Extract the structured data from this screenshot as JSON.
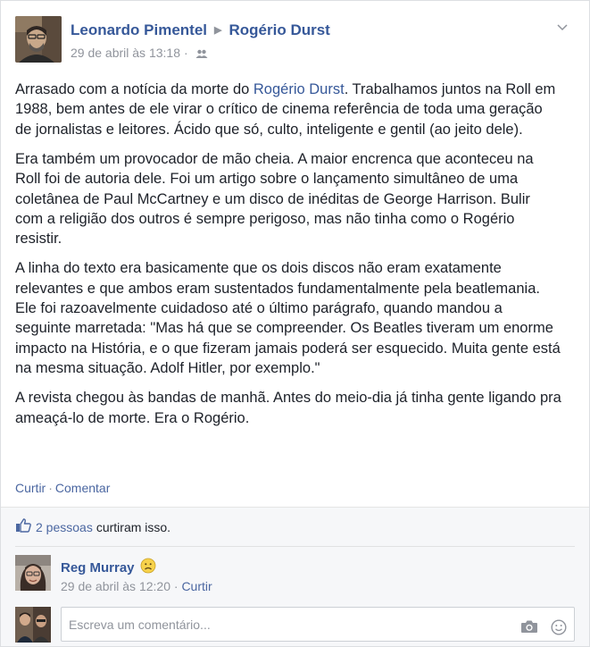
{
  "post": {
    "author": "Leonardo Pimentel",
    "target": "Rogério Durst",
    "timestamp": "29 de abril às 13:18",
    "paragraphs": [
      {
        "before": "Arrasado com a notícia da morte do ",
        "mention": "Rogério Durst",
        "after": ". Trabalhamos juntos na Roll em 1988, bem antes de ele virar o crítico de cinema referência de toda uma geração de jornalistas e leitores. Ácido que só, culto, inteligente e gentil (ao jeito dele)."
      },
      {
        "text": "Era também um provocador de mão cheia. A maior encrenca que aconteceu na Roll foi de autoria dele. Foi um artigo sobre o lançamento simultâneo de uma coletânea de Paul McCartney e um disco de inéditas de George Harrison. Bulir com a religião dos outros é sempre perigoso, mas não tinha como o Rogério resistir."
      },
      {
        "text": "A linha do texto era basicamente que os dois discos não eram exatamente relevantes e que ambos eram sustentados fundamentalmente pela beatlemania. Ele foi razoavelmente cuidadoso até o último parágrafo, quando mandou a seguinte marretada: \"Mas há que se compreender. Os Beatles tiveram um enorme impacto na História, e o que fizeram jamais poderá ser esquecido. Muita gente está na mesma situação. Adolf Hitler, por exemplo.\""
      },
      {
        "text": "A revista chegou às bandas de manhã. Antes do meio-dia já tinha gente ligando pra ameaçá-lo de morte. Era o Rogério."
      }
    ],
    "actions": {
      "like": "Curtir",
      "separator": "·",
      "comment": "Comentar"
    }
  },
  "likes": {
    "count": "2 pessoas",
    "suffix": "curtiram isso."
  },
  "comment": {
    "author": "Reg Murray",
    "timestamp": "29 de abril às 12:20",
    "separator": "·",
    "like": "Curtir"
  },
  "compose": {
    "placeholder": "Escreva um comentário..."
  },
  "icons": {
    "audience": "friends-icon",
    "menu": "chevron-down-icon",
    "like": "thumbs-up-icon",
    "emoji": "sad-face-icon",
    "camera": "camera-icon",
    "sticker": "smiley-icon"
  },
  "colors": {
    "link": "#365899",
    "meta": "#90949c",
    "ufi_bg": "#f6f7f9"
  }
}
